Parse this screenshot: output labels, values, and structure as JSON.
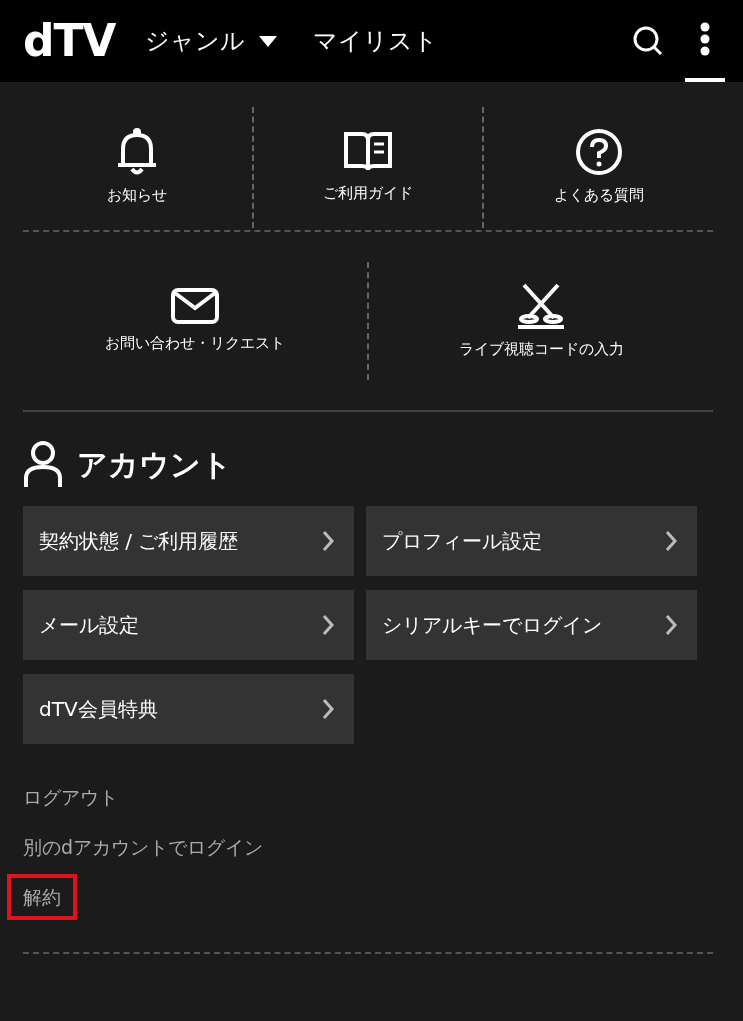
{
  "header": {
    "logo": "dTV",
    "nav": [
      {
        "label": "ジャンル",
        "dropdown": true
      },
      {
        "label": "マイリスト",
        "dropdown": false
      }
    ],
    "menu_selected": true
  },
  "shortcuts": [
    [
      {
        "kind": "bell",
        "label": "お知らせ"
      },
      {
        "kind": "book",
        "label": "ご利用ガイド"
      },
      {
        "kind": "question",
        "label": "よくある質問"
      }
    ],
    [
      {
        "kind": "mail",
        "label": "お問い合わせ・リクエスト"
      },
      {
        "kind": "live",
        "label": "ライブ視聴コードの入力"
      }
    ]
  ],
  "account": {
    "title": "アカウント",
    "buttons": [
      "契約状態 / ご利用履歴",
      "プロフィール設定",
      "メール設定",
      "シリアルキーでログイン",
      "dTV会員特典"
    ],
    "links": [
      {
        "label": "ログアウト",
        "highlighted": false
      },
      {
        "label": "別のdアカウントでログイン",
        "highlighted": false
      },
      {
        "label": "解約",
        "highlighted": true
      }
    ]
  }
}
